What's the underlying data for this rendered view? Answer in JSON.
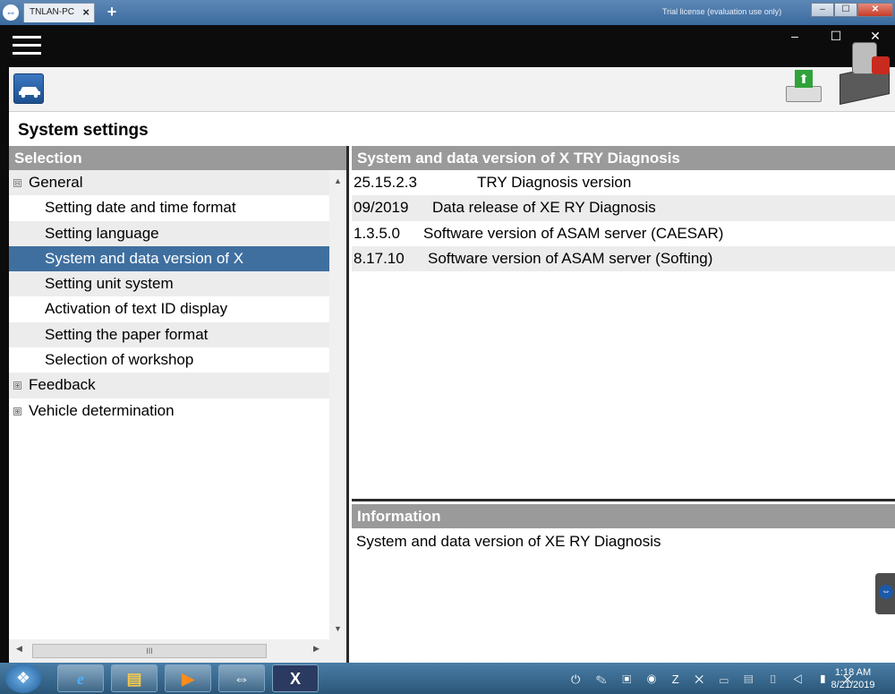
{
  "remote_session": {
    "tab_label": "TNLAN-PC",
    "tab_close": "×",
    "new_tab": "+",
    "license_notice": "Trial license (evaluation use only)"
  },
  "window_controls": {
    "minimize": "–",
    "maximize": "☐",
    "close": "✕"
  },
  "page_title": "System settings",
  "selection_panel": {
    "header": "Selection",
    "tree": [
      {
        "label": "General",
        "level": 0,
        "expander": "⊟"
      },
      {
        "label": "Setting date and time format",
        "level": 1
      },
      {
        "label": "Setting language",
        "level": 1
      },
      {
        "label": "System and data version of X",
        "level": 1,
        "selected": true
      },
      {
        "label": "Setting unit system",
        "level": 1
      },
      {
        "label": "Activation of text ID display",
        "level": 1
      },
      {
        "label": "Setting the paper format",
        "level": 1
      },
      {
        "label": "Selection of workshop",
        "level": 1
      },
      {
        "label": "Feedback",
        "level": 0,
        "expander": "⊞"
      },
      {
        "label": "Vehicle determination",
        "level": 0,
        "expander": "⊞"
      }
    ],
    "scroll_up": "▲",
    "scroll_down": "▼",
    "scroll_left": "◀",
    "scroll_right": "▶",
    "scroll_grip": "III"
  },
  "version_panel": {
    "header": "System and data version of X      TRY Diagnosis",
    "rows": [
      {
        "version": "25.15.2.3",
        "description": "TRY Diagnosis version"
      },
      {
        "version": "09/2019",
        "description": "Data release of XE    RY Diagnosis"
      },
      {
        "version": "1.3.5.0",
        "description": "Software version of ASAM server (CAESAR)"
      },
      {
        "version": "8.17.10",
        "description": "Software version of ASAM server (Softing)"
      }
    ]
  },
  "info_panel": {
    "header": "Information",
    "text": "System and data version of XE    RY Diagnosis"
  },
  "taskbar": {
    "start": "❖",
    "apps": {
      "ie": "e",
      "explorer": "▤",
      "media": "▶",
      "teamviewer": "⇔",
      "xentry": "X"
    },
    "tray": "⏻ ✎ ▣ ◉ Z ✕ ▭ ▤ ▯ ◁ ▮ ✕",
    "time": "1:18 AM",
    "date": "8/21/2019"
  },
  "colors": {
    "panel_header": "#9a9a9a",
    "selected_row": "#3f6f9f",
    "alt_row": "#ececec",
    "title_bar": "#0c0c0c"
  }
}
